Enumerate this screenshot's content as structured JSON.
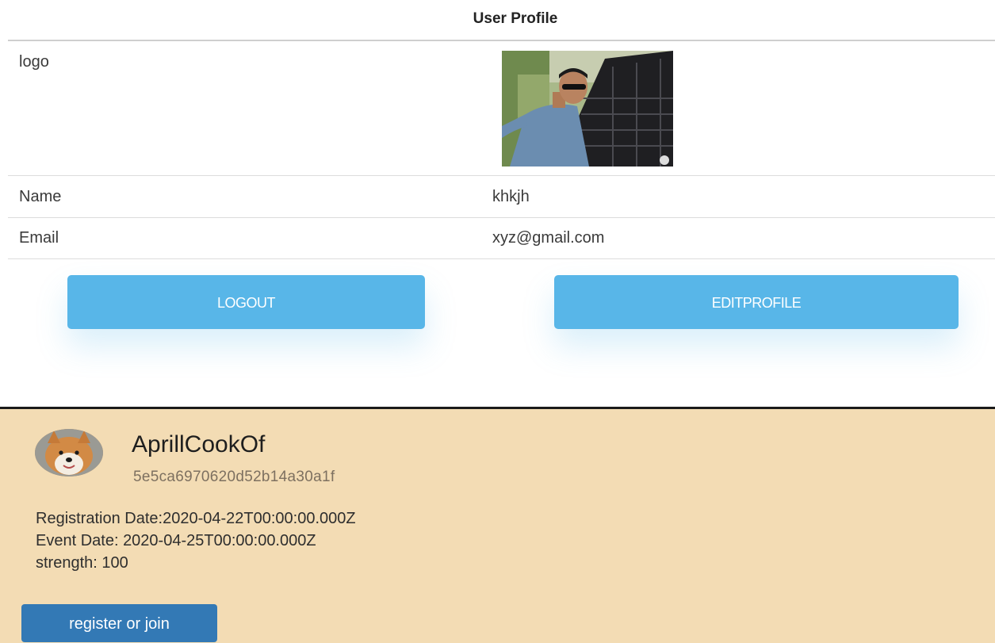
{
  "profile": {
    "title": "User Profile",
    "rows": {
      "logo_label": "logo",
      "name_label": "Name",
      "name_value": "khkjh",
      "email_label": "Email",
      "email_value": "xyz@gmail.com"
    },
    "buttons": {
      "logout": "LOGOUT",
      "edit_profile": "EDITPROFILE"
    }
  },
  "event_card": {
    "username": "AprillCookOf",
    "user_id": "5e5ca6970620d52b14a30a1f",
    "registration": {
      "label": "Registration Date:",
      "value": "2020-04-22T00:00:00.000Z"
    },
    "event": {
      "label": "Event Date: ",
      "value": "2020-04-25T00:00:00.000Z"
    },
    "strength": {
      "label": "strength: ",
      "value": "100"
    },
    "register_button": "register or join"
  },
  "colors": {
    "primary_button": "#58b6e8",
    "card_background": "#f3dcb4",
    "register_button": "#3379b5"
  }
}
